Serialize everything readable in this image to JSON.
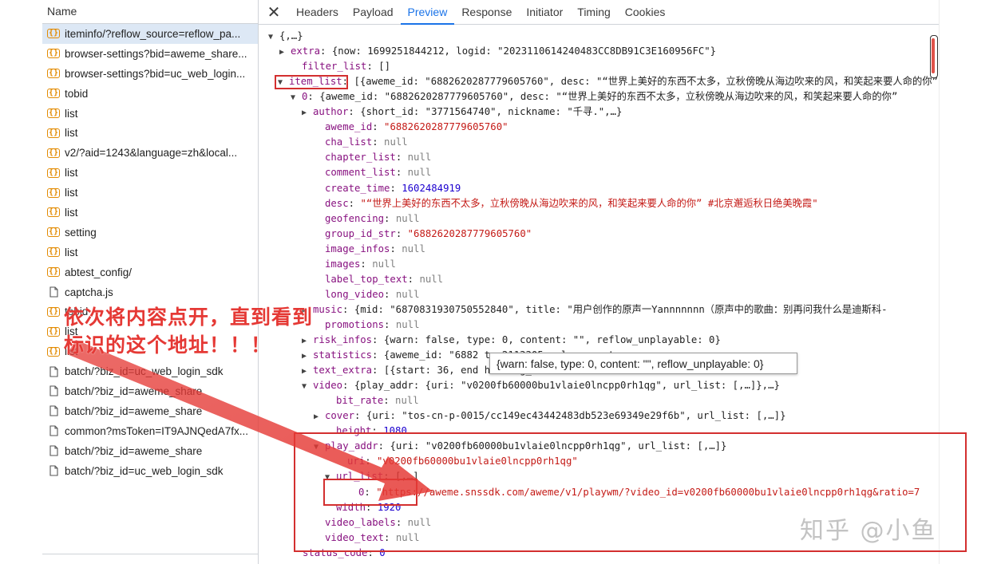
{
  "request_list": {
    "header": "Name",
    "items": [
      {
        "label": "iteminfo/?reflow_source=reflow_pa...",
        "icon": "xhr-icon",
        "selected": true
      },
      {
        "label": "browser-settings?bid=aweme_share...",
        "icon": "xhr-icon"
      },
      {
        "label": "browser-settings?bid=uc_web_login...",
        "icon": "xhr-icon"
      },
      {
        "label": "tobid",
        "icon": "xhr-icon"
      },
      {
        "label": "list",
        "icon": "xhr-icon"
      },
      {
        "label": "list",
        "icon": "xhr-icon"
      },
      {
        "label": "v2/?aid=1243&language=zh&local...",
        "icon": "xhr-icon"
      },
      {
        "label": "list",
        "icon": "xhr-icon"
      },
      {
        "label": "list",
        "icon": "xhr-icon"
      },
      {
        "label": "list",
        "icon": "xhr-icon"
      },
      {
        "label": "setting",
        "icon": "xhr-icon"
      },
      {
        "label": "list",
        "icon": "xhr-icon"
      },
      {
        "label": "abtest_config/",
        "icon": "xhr-icon"
      },
      {
        "label": "captcha.js",
        "icon": "document-icon"
      },
      {
        "label": "tobid",
        "icon": "xhr-icon"
      },
      {
        "label": "list",
        "icon": "xhr-icon"
      },
      {
        "label": "list",
        "icon": "xhr-icon"
      },
      {
        "label": "batch/?biz_id=uc_web_login_sdk",
        "icon": "document-icon"
      },
      {
        "label": "batch/?biz_id=aweme_share",
        "icon": "document-icon"
      },
      {
        "label": "batch/?biz_id=aweme_share",
        "icon": "document-icon"
      },
      {
        "label": "common?msToken=IT9AJNQedA7fx...",
        "icon": "document-icon"
      },
      {
        "label": "batch/?biz_id=aweme_share",
        "icon": "document-icon"
      },
      {
        "label": "batch/?biz_id=uc_web_login_sdk",
        "icon": "document-icon"
      }
    ]
  },
  "tabs": {
    "close_label": "✕",
    "items": [
      "Headers",
      "Payload",
      "Preview",
      "Response",
      "Initiator",
      "Timing",
      "Cookies"
    ],
    "active": "Preview"
  },
  "preview": {
    "lines": [
      {
        "tri": "▼",
        "parts": [
          [
            "o",
            "{,…}"
          ]
        ]
      },
      {
        "tri": "▶",
        "parts": [
          [
            "k",
            "extra"
          ],
          [
            "o",
            ": {now: 1699251844212, logid: \"2023110614240483CC8DB91C3E160956FC\"}"
          ]
        ]
      },
      {
        "tri": "",
        "parts": [
          [
            "k",
            "filter_list"
          ],
          [
            "o",
            ": []"
          ]
        ]
      },
      {
        "tri": "▼",
        "parts": [
          [
            "k",
            "item_list"
          ],
          [
            "o",
            ": [{aweme_id: \"6882620287779605760\", desc: \"“世界上美好的东西不太多，立秋傍晚从海边吹来的风，和笑起来要人命的你”"
          ]
        ]
      },
      {
        "tri": "▼",
        "parts": [
          [
            "k",
            "0"
          ],
          [
            "o",
            ": {aweme_id: \"6882620287779605760\", desc: \"“世界上美好的东西不太多，立秋傍晚从海边吹来的风，和笑起来要人命的你”"
          ]
        ]
      },
      {
        "tri": "▶",
        "parts": [
          [
            "k",
            "author"
          ],
          [
            "o",
            ": {short_id: \"3771564740\", nickname: \"千寻.\",…}"
          ]
        ]
      },
      {
        "tri": "",
        "parts": [
          [
            "k",
            "aweme_id"
          ],
          [
            "o",
            ": "
          ],
          [
            "s",
            "\"6882620287779605760\""
          ]
        ]
      },
      {
        "tri": "",
        "parts": [
          [
            "k",
            "cha_list"
          ],
          [
            "o",
            ": "
          ],
          [
            "n",
            "null"
          ]
        ]
      },
      {
        "tri": "",
        "parts": [
          [
            "k",
            "chapter_list"
          ],
          [
            "o",
            ": "
          ],
          [
            "n",
            "null"
          ]
        ]
      },
      {
        "tri": "",
        "parts": [
          [
            "k",
            "comment_list"
          ],
          [
            "o",
            ": "
          ],
          [
            "n",
            "null"
          ]
        ]
      },
      {
        "tri": "",
        "parts": [
          [
            "k",
            "create_time"
          ],
          [
            "o",
            ": "
          ],
          [
            "d",
            "1602484919"
          ]
        ]
      },
      {
        "tri": "",
        "parts": [
          [
            "k",
            "desc"
          ],
          [
            "o",
            ": "
          ],
          [
            "s",
            "\"“世界上美好的东西不太多，立秋傍晚从海边吹来的风，和笑起来要人命的你” #北京邂逅秋日绝美晚霞\""
          ]
        ]
      },
      {
        "tri": "",
        "parts": [
          [
            "k",
            "geofencing"
          ],
          [
            "o",
            ": "
          ],
          [
            "n",
            "null"
          ]
        ]
      },
      {
        "tri": "",
        "parts": [
          [
            "k",
            "group_id_str"
          ],
          [
            "o",
            ": "
          ],
          [
            "s",
            "\"6882620287779605760\""
          ]
        ]
      },
      {
        "tri": "",
        "parts": [
          [
            "k",
            "image_infos"
          ],
          [
            "o",
            ": "
          ],
          [
            "n",
            "null"
          ]
        ]
      },
      {
        "tri": "",
        "parts": [
          [
            "k",
            "images"
          ],
          [
            "o",
            ": "
          ],
          [
            "n",
            "null"
          ]
        ]
      },
      {
        "tri": "",
        "parts": [
          [
            "k",
            "label_top_text"
          ],
          [
            "o",
            ": "
          ],
          [
            "n",
            "null"
          ]
        ]
      },
      {
        "tri": "",
        "parts": [
          [
            "k",
            "long_video"
          ],
          [
            "o",
            ": "
          ],
          [
            "n",
            "null"
          ]
        ]
      },
      {
        "tri": "▶",
        "parts": [
          [
            "k",
            "music"
          ],
          [
            "o",
            ": {mid: \"6870831930750552840\", title: \"用户创作的原声一Yannnnnnn（原声中的歌曲：别再问我什么是迪斯科-"
          ]
        ]
      },
      {
        "tri": "",
        "parts": [
          [
            "k",
            "promotions"
          ],
          [
            "o",
            ": "
          ],
          [
            "n",
            "null"
          ]
        ]
      },
      {
        "tri": "▶",
        "parts": [
          [
            "k",
            "risk_infos"
          ],
          [
            "o",
            ": {warn: false, type: 0, content: \"\", reflow_unplayable: 0}"
          ]
        ]
      },
      {
        "tri": "▶",
        "parts": [
          [
            "k",
            "statistics"
          ],
          [
            "o",
            ": {aweme_id: \"6882                                                t: 2113305, play_count"
          ]
        ]
      },
      {
        "tri": "▶",
        "parts": [
          [
            "k",
            "text_extra"
          ],
          [
            "o",
            ": [{start: 36, end                                                 hashtag_id: 168027311"
          ]
        ]
      },
      {
        "tri": "▼",
        "parts": [
          [
            "k",
            "video"
          ],
          [
            "o",
            ": {play_addr: {uri: \"v0200fb60000bu1vlaie0lncpp0rh1qg\", url_list: [,…]},…}"
          ]
        ]
      },
      {
        "tri": "",
        "parts": [
          [
            "k",
            "bit_rate"
          ],
          [
            "o",
            ": "
          ],
          [
            "n",
            "null"
          ]
        ]
      },
      {
        "tri": "▶",
        "parts": [
          [
            "k",
            "cover"
          ],
          [
            "o",
            ": {uri: \"tos-cn-p-0015/cc149ec43442483db523e69349e29f6b\", url_list: [,…]}"
          ]
        ]
      },
      {
        "tri": "",
        "parts": [
          [
            "k",
            "height"
          ],
          [
            "o",
            ": "
          ],
          [
            "d",
            "1080"
          ]
        ]
      },
      {
        "tri": "▼",
        "parts": [
          [
            "k",
            "play_addr"
          ],
          [
            "o",
            ": {uri: \"v0200fb60000bu1vlaie0lncpp0rh1qg\", url_list: [,…]}"
          ]
        ]
      },
      {
        "tri": "",
        "parts": [
          [
            "k",
            "uri"
          ],
          [
            "o",
            ": "
          ],
          [
            "s",
            "\"v0200fb60000bu1vlaie0lncpp0rh1qg\""
          ]
        ]
      },
      {
        "tri": "▼",
        "parts": [
          [
            "k",
            "url_list"
          ],
          [
            "o",
            ": [,…]"
          ]
        ]
      },
      {
        "tri": "",
        "parts": [
          [
            "k",
            "0"
          ],
          [
            "o",
            ": "
          ],
          [
            "s",
            "\"https://aweme.snssdk.com/aweme/v1/playwm/?video_id=v0200fb60000bu1vlaie0lncpp0rh1qg&ratio=7"
          ]
        ]
      },
      {
        "tri": "",
        "parts": [
          [
            "k",
            "width"
          ],
          [
            "o",
            ": "
          ],
          [
            "d",
            "1920"
          ]
        ]
      },
      {
        "tri": "",
        "parts": [
          [
            "k",
            "video_labels"
          ],
          [
            "o",
            ": "
          ],
          [
            "n",
            "null"
          ]
        ]
      },
      {
        "tri": "",
        "parts": [
          [
            "k",
            "video_text"
          ],
          [
            "o",
            ": "
          ],
          [
            "n",
            "null"
          ]
        ]
      },
      {
        "tri": "",
        "parts": [
          [
            "k",
            "status_code"
          ],
          [
            "o",
            ": "
          ],
          [
            "d",
            "0"
          ]
        ]
      }
    ]
  },
  "tooltip": "{warn: false, type: 0, content: \"\", reflow_unplayable: 0}",
  "annotation": {
    "line1": "依次将内容点开，直到看到",
    "line2": "标识的这个地址！！！"
  },
  "watermark": "知乎 @小鱼",
  "colors": {
    "annotation_red": "#e53935",
    "box_red": "#d32f2f",
    "active_tab_blue": "#1a73e8",
    "selected_row": "#dde8f5"
  }
}
